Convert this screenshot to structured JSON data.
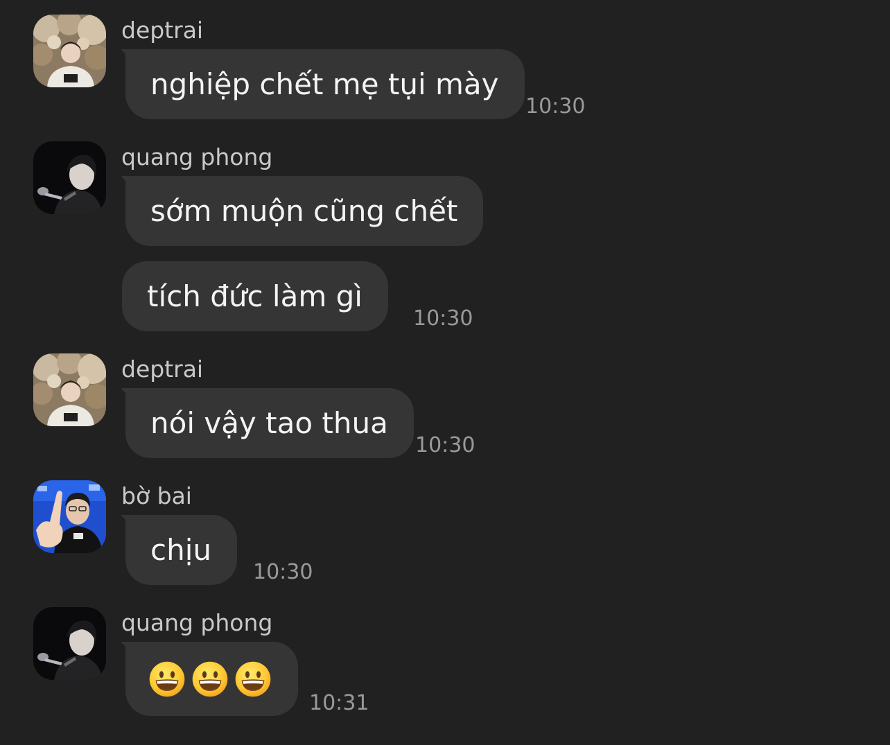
{
  "messages": [
    {
      "sender": "deptrai",
      "avatar": "deptrai-avatar",
      "bubbles": [
        "nghiệp chết mẹ tụi mày"
      ],
      "time": "10:30"
    },
    {
      "sender": "quang phong",
      "avatar": "quang-phong-avatar",
      "bubbles": [
        "sớm muộn cũng chết",
        "tích đức làm gì"
      ],
      "time": "10:30"
    },
    {
      "sender": "deptrai",
      "avatar": "deptrai-avatar",
      "bubbles": [
        "nói vậy tao thua"
      ],
      "time": "10:30"
    },
    {
      "sender": "bờ bai",
      "avatar": "bo-bai-avatar",
      "bubbles": [
        "chịu"
      ],
      "time": "10:30"
    },
    {
      "sender": "quang phong",
      "avatar": "quang-phong-avatar",
      "emoji": [
        "grinning-face",
        "grinning-face",
        "grinning-face"
      ],
      "time": "10:31"
    }
  ],
  "colors": {
    "background": "#212121",
    "bubble": "#353535",
    "message_text": "#f4f4f4",
    "sender_text": "#c9c9c9",
    "time_text": "#9a9a9a"
  }
}
